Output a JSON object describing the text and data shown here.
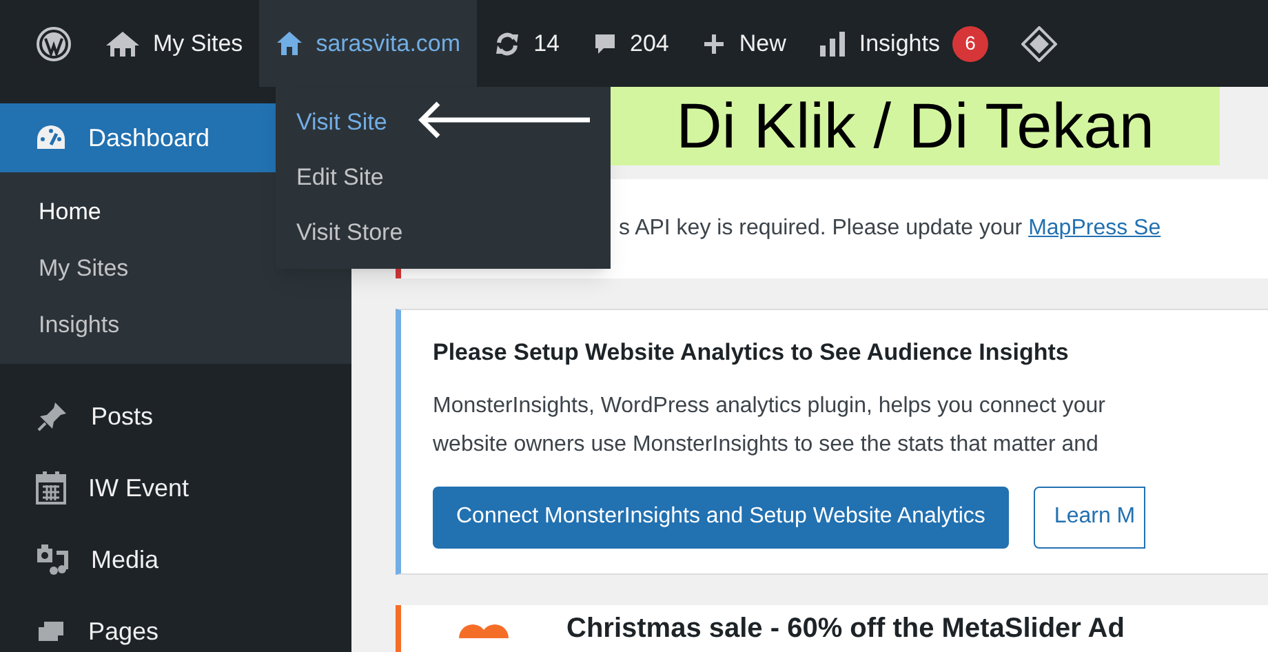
{
  "admin_bar": {
    "items": [
      {
        "kind": "logo",
        "selected": false
      },
      {
        "kind": "mysites",
        "label": "My Sites",
        "selected": false
      },
      {
        "kind": "site",
        "label": "sarasvita.com",
        "selected": true
      },
      {
        "kind": "updates",
        "label": "14",
        "selected": false
      },
      {
        "kind": "comments",
        "label": "204",
        "selected": false
      },
      {
        "kind": "new",
        "label": "New",
        "selected": false
      },
      {
        "kind": "insights",
        "label": "Insights",
        "badge": "6",
        "selected": false
      },
      {
        "kind": "diamond",
        "selected": false
      }
    ]
  },
  "site_menu": {
    "items": [
      {
        "label": "Visit Site",
        "selected": true
      },
      {
        "label": "Edit Site",
        "selected": false
      },
      {
        "label": "Visit Store",
        "selected": false
      }
    ]
  },
  "annotation": {
    "text": "Di Klik / Di Tekan"
  },
  "sidebar": {
    "items": [
      {
        "kind": "dashboard",
        "label": "Dashboard",
        "selected": true,
        "children": [
          {
            "label": "Home",
            "selected": true
          },
          {
            "label": "My Sites",
            "selected": false
          },
          {
            "label": "Insights",
            "selected": false
          }
        ]
      },
      {
        "kind": "posts",
        "label": "Posts",
        "selected": false
      },
      {
        "kind": "event",
        "label": "IW Event",
        "selected": false
      },
      {
        "kind": "media",
        "label": "Media",
        "selected": false
      },
      {
        "kind": "pages",
        "label": "Pages",
        "selected": false
      }
    ]
  },
  "notices": [
    {
      "kind": "api",
      "text": "s API key is required. Please update your",
      "link": "MapPress Se"
    },
    {
      "kind": "analytics",
      "title": "Please Setup Website Analytics to See Audience Insights",
      "lines": [
        "MonsterInsights, WordPress analytics plugin, helps you connect your",
        "website owners use MonsterInsights to see the stats that matter and"
      ],
      "primary_button": "Connect MonsterInsights and Setup Website Analytics",
      "secondary_button": "Learn M"
    },
    {
      "kind": "sale",
      "title": "Christmas sale - 60% off the MetaSlider Ad"
    }
  ]
}
